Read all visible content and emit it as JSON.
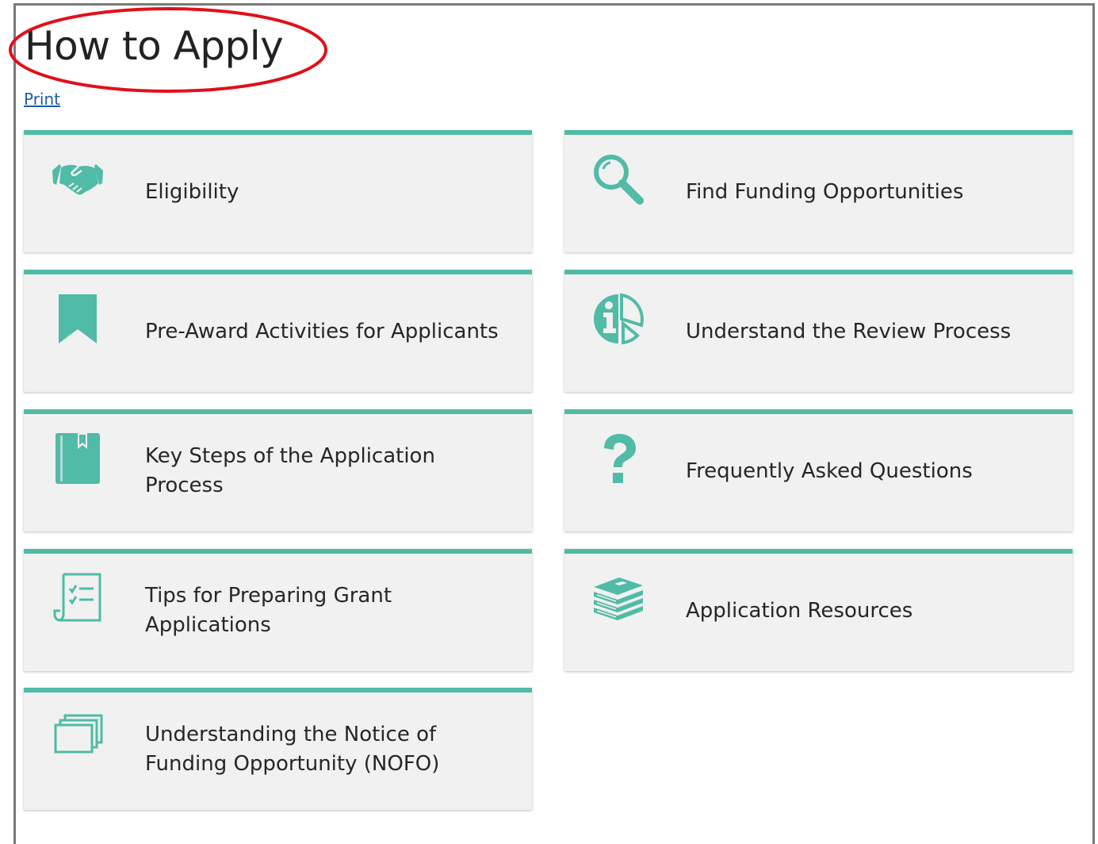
{
  "page": {
    "title": "How to Apply",
    "print_link": "Print"
  },
  "colors": {
    "accent": "#50bba6",
    "card_bg": "#f1f1f1",
    "highlight": "#e0101a",
    "link": "#1a5ea8"
  },
  "cards": [
    {
      "label": "Eligibility",
      "icon": "handshake-icon"
    },
    {
      "label": "Find Funding Opportunities",
      "icon": "magnifier-icon"
    },
    {
      "label": "Pre-Award Activities for Applicants",
      "icon": "bookmark-icon"
    },
    {
      "label": "Understand the Review Process",
      "icon": "info-clock-icon"
    },
    {
      "label": "Key Steps of the Application Process",
      "icon": "book-icon"
    },
    {
      "label": "Frequently Asked Questions",
      "icon": "question-icon"
    },
    {
      "label": "Tips for Preparing Grant Applications",
      "icon": "checklist-icon"
    },
    {
      "label": "Application Resources",
      "icon": "book-stack-icon"
    },
    {
      "label": "Understanding the Notice of Funding Opportunity (NOFO)",
      "icon": "documents-stack-icon"
    }
  ]
}
